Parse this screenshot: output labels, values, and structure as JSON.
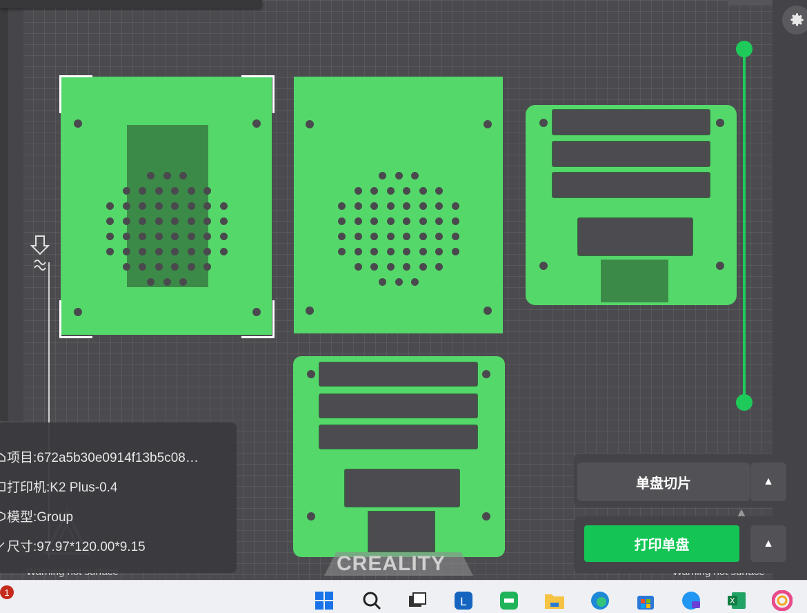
{
  "project_info": {
    "project_label": "项目:672a5b30e0914f13b5c08…",
    "printer_label": "打印机:K2 Plus-0.4",
    "model_label": "模型:Group",
    "size_label": "尺寸:97.97*120.00*9.15"
  },
  "bed": {
    "warning_text": "Warning hot surface",
    "brand_text": "CREALITY"
  },
  "actions": {
    "slice_label": "单盘切片",
    "print_label": "打印单盘"
  },
  "taskbar": {
    "notification_count": "1",
    "icons": [
      "start-icon",
      "search-icon",
      "task-view-icon",
      "lenovo-icon",
      "wechat-icon",
      "file-explorer-icon",
      "edge-icon",
      "store-icon",
      "edge-ai-icon",
      "excel-icon",
      "photos-icon"
    ]
  },
  "colors": {
    "plate_green": "#55d86a",
    "accent_green": "#14c556",
    "bed_gray": "#4b4b4f"
  }
}
